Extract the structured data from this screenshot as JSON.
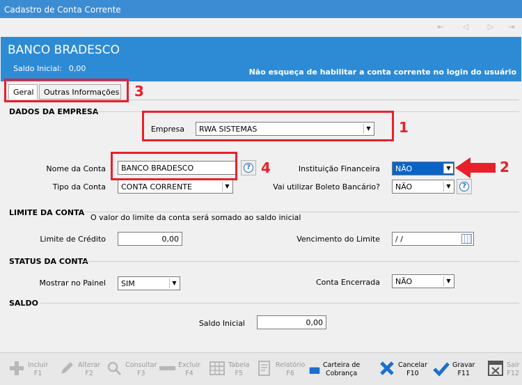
{
  "window": {
    "title": "Cadastro de Conta Corrente"
  },
  "nav": {
    "first": "⇤",
    "prev": "◁",
    "next": "▷",
    "last": "⇥"
  },
  "header": {
    "bank_name": "BANCO BRADESCO",
    "saldo_label": "Saldo Inicial:",
    "saldo_value": "0,00",
    "notice": "Não esqueça de habilitar a conta corrente no login do usuário"
  },
  "tabs": [
    {
      "label": "Geral",
      "active": true
    },
    {
      "label": "Outras Informações",
      "active": false
    }
  ],
  "sections": {
    "empresa": "DADOS DA EMPRESA",
    "limite": "LIMITE DA CONTA",
    "status": "STATUS DA CONTA",
    "saldo": "SALDO"
  },
  "fields": {
    "empresa": {
      "label": "Empresa",
      "value": "RWA SISTEMAS"
    },
    "nome_conta": {
      "label": "Nome da Conta",
      "value": "BANCO BRADESCO"
    },
    "instituicao": {
      "label": "Instituição Financeira",
      "value": "NÃO"
    },
    "tipo_conta": {
      "label": "Tipo da Conta",
      "value": "CONTA CORRENTE"
    },
    "boleto": {
      "label": "Vai utilizar Boleto Bancário?",
      "value": "NÃO"
    },
    "limite_note": "O valor do limite da conta será somado ao saldo inicial",
    "limite_credito": {
      "label": "Limite de Crédito",
      "value": "0,00"
    },
    "vencimento": {
      "label": "Vencimento do Limite",
      "value": " /  /"
    },
    "mostrar_painel": {
      "label": "Mostrar no Painel",
      "value": "SIM"
    },
    "conta_encerrada": {
      "label": "Conta Encerrada",
      "value": "NÃO"
    },
    "saldo_inicial": {
      "label": "Saldo Inicial",
      "value": "0,00"
    }
  },
  "annotations": {
    "n1": "1",
    "n2": "2",
    "n3": "3",
    "n4": "4",
    "color": "#e8202a"
  },
  "toolbar": {
    "incluir": {
      "label": "Incluir",
      "key": "F1"
    },
    "alterar": {
      "label": "Alterar",
      "key": "F2"
    },
    "consultar": {
      "label": "Consultar",
      "key": "F3"
    },
    "excluir": {
      "label": "Excluir",
      "key": "F4"
    },
    "tabela": {
      "label": "Tabela",
      "key": "F5"
    },
    "relatorio": {
      "label": "Relatório",
      "key": "F6"
    },
    "carteira": {
      "label": "Carteira de",
      "label2": "Cobrança"
    },
    "cancelar": {
      "label": "Cancelar",
      "key": "F10"
    },
    "gravar": {
      "label": "Gravar",
      "key": "F11"
    },
    "sair": {
      "label": "Sair",
      "key": "F12"
    }
  }
}
